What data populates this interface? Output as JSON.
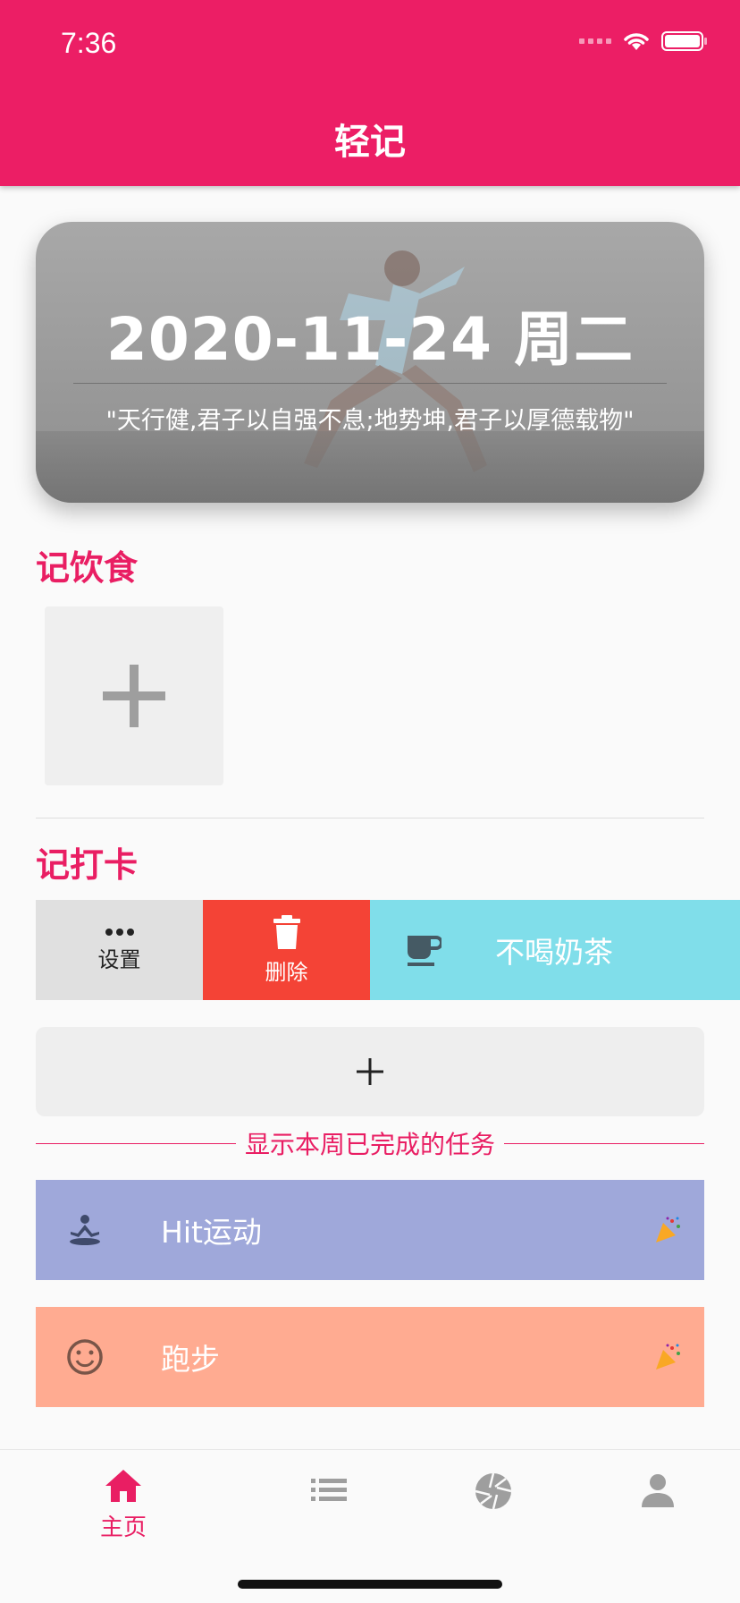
{
  "status_bar": {
    "time": "7:36"
  },
  "header": {
    "title": "轻记"
  },
  "banner": {
    "date": "2020-11-24 周二",
    "quote": "\"天行健,君子以自强不息;地势坤,君子以厚德载物\""
  },
  "food": {
    "title": "记饮食"
  },
  "checkin": {
    "title": "记打卡",
    "actions": {
      "settings": "设置",
      "delete": "删除"
    },
    "task": {
      "label": "不喝奶茶",
      "icon": "coffee-cup-icon",
      "color": "#80deea"
    }
  },
  "week": {
    "toggle_label": "显示本周已完成的任务",
    "completed": [
      {
        "label": "Hit运动",
        "icon": "meditation-icon",
        "color": "#9fa8da"
      },
      {
        "label": "跑步",
        "icon": "smiley-icon",
        "color": "#ffab91"
      }
    ]
  },
  "colors": {
    "primary": "#ec1e65",
    "accent": "#e91e63",
    "delete": "#f44336"
  },
  "bottom_nav": {
    "items": [
      {
        "icon": "home-icon",
        "label": "主页",
        "active": true
      },
      {
        "icon": "list-icon",
        "label": "",
        "active": false
      },
      {
        "icon": "camera-shutter-icon",
        "label": "",
        "active": false
      },
      {
        "icon": "person-icon",
        "label": "",
        "active": false
      }
    ]
  }
}
